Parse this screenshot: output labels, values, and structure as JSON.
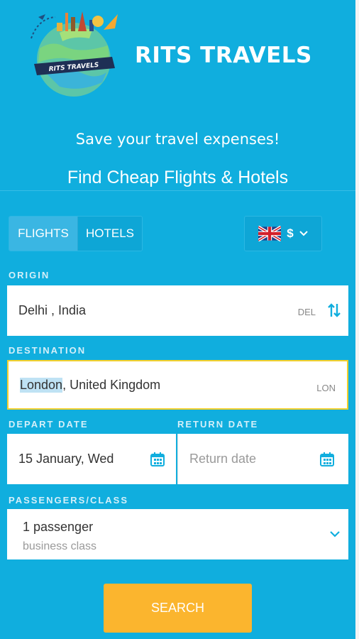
{
  "header": {
    "logo_text": "RITS TRAVELS",
    "brand": "RITS TRAVELS",
    "tagline": "Save your travel expenses!",
    "headline": "Find Cheap Flights & Hotels"
  },
  "tabs": [
    {
      "label": "FLIGHTS",
      "active": true
    },
    {
      "label": "HOTELS",
      "active": false
    }
  ],
  "currency": {
    "flag": "uk-flag-icon",
    "symbol": "$"
  },
  "origin": {
    "label": "ORIGIN",
    "city": "Delhi , India",
    "code": "DEL",
    "swap_icon": "swap-arrows-icon"
  },
  "destination": {
    "label": "DESTINATION",
    "city_highlight": "London",
    "city_rest": " , United Kingdom",
    "code": "LON"
  },
  "depart": {
    "label": "DEPART DATE",
    "value": "15 January, Wed",
    "icon": "calendar-icon"
  },
  "return": {
    "label": "RETURN DATE",
    "placeholder": "Return date",
    "icon": "calendar-icon"
  },
  "passengers": {
    "label": "PASSENGERS/CLASS",
    "count": "1 passenger",
    "class": "business class",
    "icon": "chevron-down-icon"
  },
  "search": {
    "label": "SEARCH"
  },
  "colors": {
    "background": "#10aede",
    "accent": "#fbb52e",
    "focus_border": "#f3d02c"
  }
}
